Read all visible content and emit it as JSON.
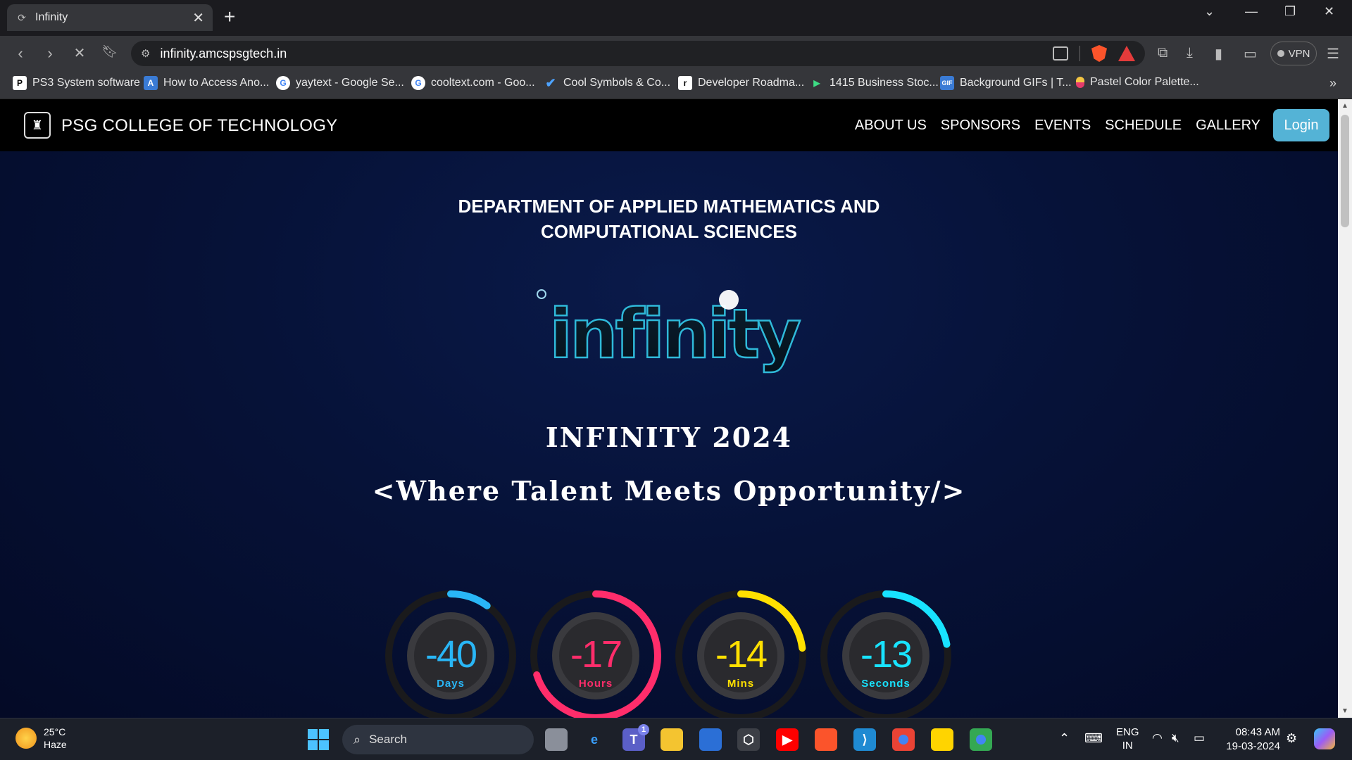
{
  "browser": {
    "tab_title": "Infinity",
    "tab_close": "✕",
    "new_tab": "+",
    "url": "infinity.amcspsgtech.in",
    "vpn_label": "VPN",
    "bookmarks": [
      {
        "label": "PS3 System software",
        "icon": "playstation-icon",
        "color": "#ffffff"
      },
      {
        "label": "How to Access Ano...",
        "icon": "av-icon",
        "color": "#3a7bd5"
      },
      {
        "label": "yaytext - Google Se...",
        "icon": "google-icon",
        "color": "#ffffff"
      },
      {
        "label": "cooltext.com - Goo...",
        "icon": "google-icon",
        "color": "#ffffff"
      },
      {
        "label": "Cool Symbols & Co...",
        "icon": "check-icon",
        "color": "#4da3ff"
      },
      {
        "label": "Developer Roadma...",
        "icon": "roadmap-icon",
        "color": "#ffffff"
      },
      {
        "label": "1415 Business Stoc...",
        "icon": "play-icon",
        "color": "#3ddc84"
      },
      {
        "label": "Background GIFs | T...",
        "icon": "gif-icon",
        "color": "#3a7bd5"
      },
      {
        "label": "Pastel Color Palette...",
        "icon": "palette-icon",
        "color": "#f4c542"
      }
    ],
    "bookmarks_more": "»"
  },
  "site": {
    "college_name": "PSG COLLEGE OF TECHNOLOGY",
    "nav": [
      "ABOUT US",
      "SPONSORS",
      "EVENTS",
      "SCHEDULE",
      "GALLERY"
    ],
    "login_label": "Login",
    "department_line1": "DEPARTMENT OF APPLIED MATHEMATICS AND",
    "department_line2": "COMPUTATIONAL SCIENCES",
    "logo_text": "infinity",
    "event_title": "INFINITY 2024",
    "tagline": "<Where Talent Meets Opportunity/>",
    "countdown": [
      {
        "value": "-40",
        "unit": "Days",
        "color": "#29b6f6",
        "fraction": 0.1
      },
      {
        "value": "-17",
        "unit": "Hours",
        "color": "#ff2d6b",
        "fraction": 0.7
      },
      {
        "value": "-14",
        "unit": "Mins",
        "color": "#ffe000",
        "fraction": 0.23
      },
      {
        "value": "-13",
        "unit": "Seconds",
        "color": "#18e3ff",
        "fraction": 0.22
      }
    ]
  },
  "taskbar": {
    "temperature": "25°C",
    "weather": "Haze",
    "search_label": "Search",
    "language": "ENG",
    "region": "IN",
    "time": "08:43 AM",
    "date": "19-03-2024",
    "teams_badge": "1"
  }
}
